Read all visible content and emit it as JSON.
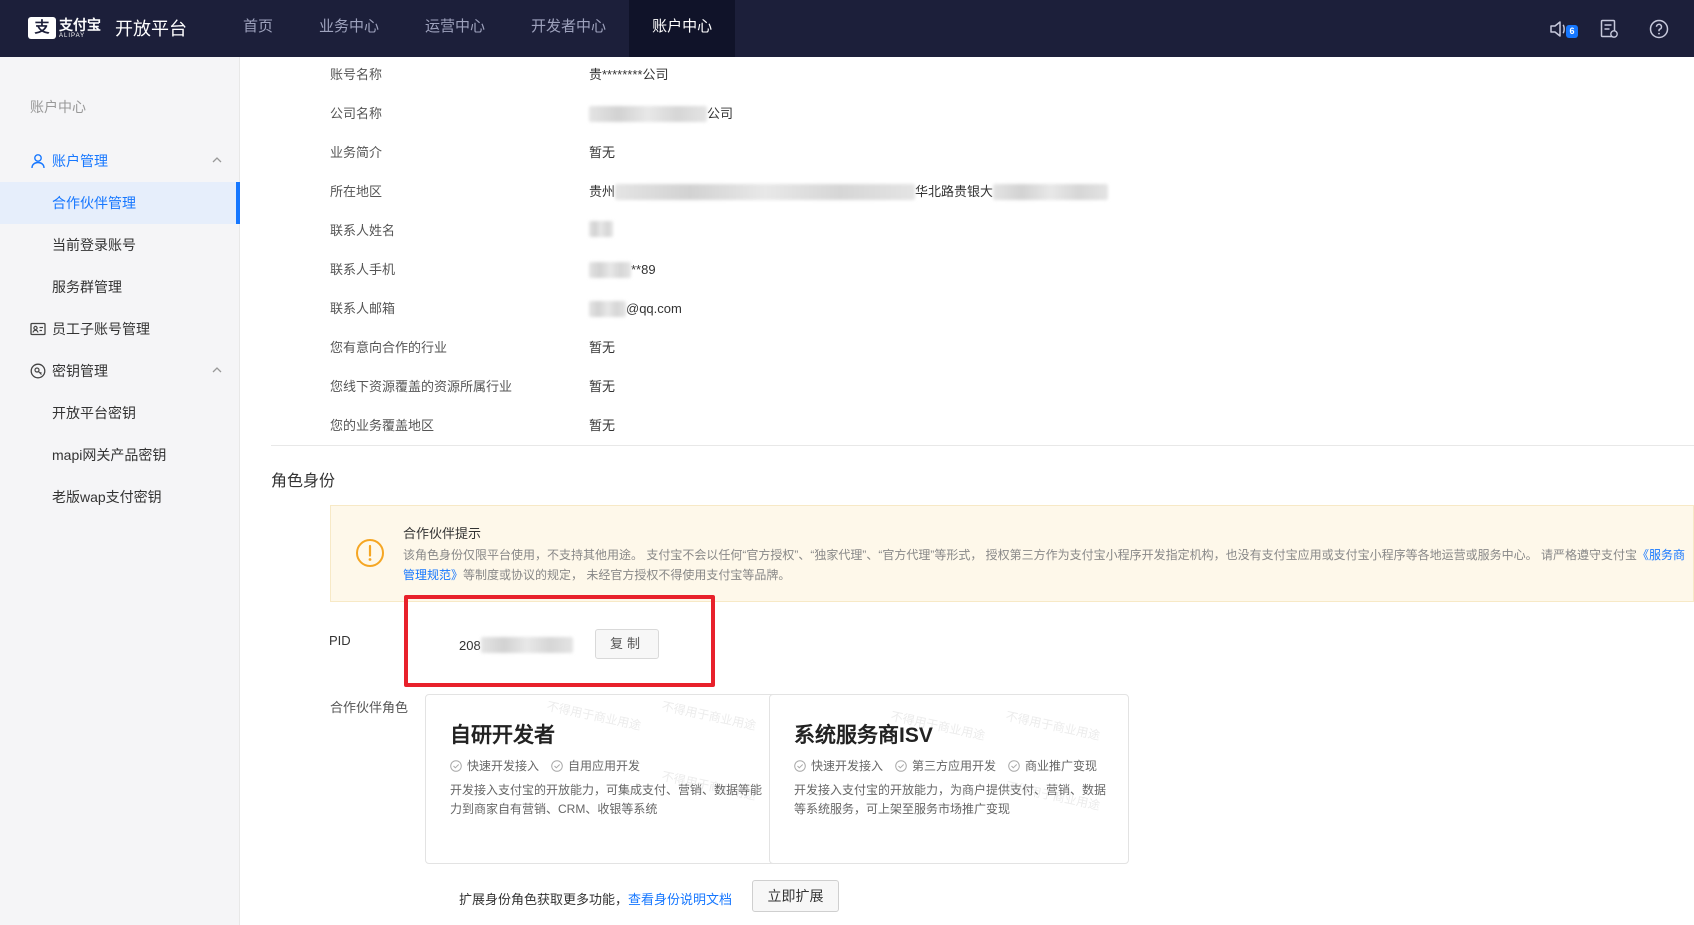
{
  "header": {
    "logo_cn": "支付宝",
    "logo_en": "ALIPAY",
    "logo_mark": "支",
    "title": "开放平台",
    "nav": [
      "首页",
      "业务中心",
      "运营中心",
      "开发者中心",
      "账户中心"
    ],
    "active_nav": "账户中心",
    "notification_count": "6",
    "icons": [
      "speaker-icon",
      "document-list-icon",
      "help-icon"
    ]
  },
  "sidebar": {
    "title": "账户中心",
    "account_management": "账户管理",
    "partner_management": "合作伙伴管理",
    "current_login": "当前登录账号",
    "service_group": "服务群管理",
    "employee_accounts": "员工子账号管理",
    "key_management": "密钥管理",
    "open_platform_key": "开放平台密钥",
    "mapi_key": "mapi网关产品密钥",
    "wap_key": "老版wap支付密钥"
  },
  "info": {
    "account_name_label": "账号名称",
    "account_name_value": "贵********公司",
    "company_name_label": "公司名称",
    "company_name_suffix": "公司",
    "business_intro_label": "业务简介",
    "business_intro_value": "暂无",
    "region_label": "所在地区",
    "region_prefix": "贵州",
    "region_middle": "华北路贵银大",
    "contact_name_label": "联系人姓名",
    "contact_phone_label": "联系人手机",
    "contact_phone_suffix": "**89",
    "contact_email_label": "联系人邮箱",
    "contact_email_suffix": "@qq.com",
    "industry_label": "您有意向合作的行业",
    "industry_value": "暂无",
    "offline_label": "您线下资源覆盖的资源所属行业",
    "offline_value": "暂无",
    "coverage_label": "您的业务覆盖地区",
    "coverage_value": "暂无"
  },
  "role": {
    "section_title": "角色身份",
    "notice_title": "合作伙伴提示",
    "notice_body": "该角色身份仅限平台使用，不支持其他用途。 支付宝不会以任何“官方授权”、“独家代理”、“官方代理”等形式， 授权第三方作为支付宝小程序开发指定机构，也没有支付宝应用或支付宝小程序等各地运营或服务中心。 请严格遵守支付宝",
    "notice_link": "《服务商管理规范》",
    "notice_tail": "等制度或协议的规定， 未经官方授权不得使用支付宝等品牌。",
    "pid_label": "PID",
    "pid_prefix": "208",
    "copy_button": "复制",
    "partner_role_label": "合作伙伴角色",
    "watermark": "不得用于商业用途"
  },
  "cards": [
    {
      "title": "自研开发者",
      "tags": [
        "快速开发接入",
        "自用应用开发"
      ],
      "desc": "开发接入支付宝的开放能力，可集成支付、营销、数据等能力到商家自有营销、CRM、收银等系统"
    },
    {
      "title": "系统服务商ISV",
      "tags": [
        "快速开发接入",
        "第三方应用开发",
        "商业推广变现"
      ],
      "desc": "开发接入支付宝的开放能力，为商户提供支付、营销、数据等系统服务，可上架至服务市场推广变现"
    }
  ],
  "footer": {
    "expand_text": "扩展身份角色获取更多功能，",
    "expand_link": "查看身份说明文档",
    "expand_button": "立即扩展"
  },
  "colors": {
    "nav_bg": "#1c1f3a",
    "accent": "#1677ff",
    "highlight_box": "#e8212b",
    "notice_bg": "#fef8ea",
    "notice_icon": "#f5a623"
  }
}
